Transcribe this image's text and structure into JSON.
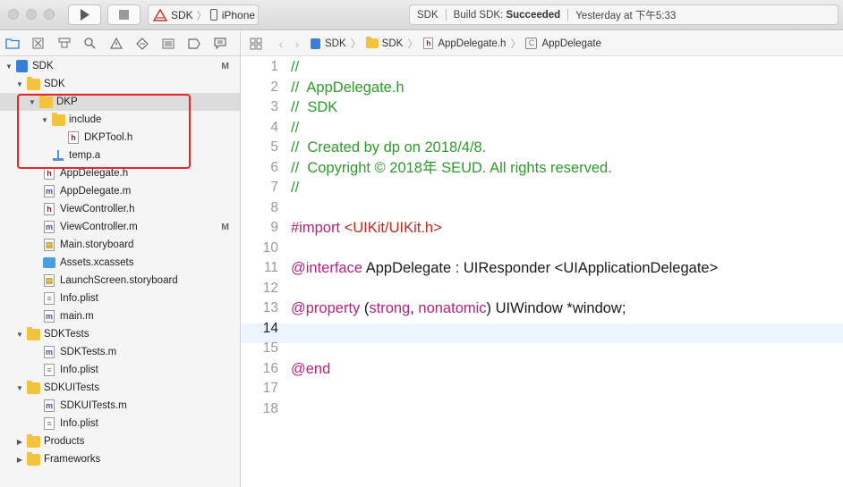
{
  "toolbar": {
    "scheme_target": "SDK",
    "scheme_device": "iPhone",
    "status_project": "SDK",
    "status_message_prefix": "Build SDK: ",
    "status_message_result": "Succeeded",
    "status_time": "Yesterday at 下午5:33"
  },
  "jumpbar": {
    "crumbs": [
      "SDK",
      "SDK",
      "AppDelegate.h",
      "AppDelegate"
    ]
  },
  "navigator": {
    "items": [
      {
        "label": "SDK",
        "badge": "M"
      },
      {
        "label": "SDK",
        "badge": ""
      },
      {
        "label": "DKP",
        "badge": ""
      },
      {
        "label": "include",
        "badge": ""
      },
      {
        "label": "DKPTool.h",
        "badge": ""
      },
      {
        "label": "temp.a",
        "badge": ""
      },
      {
        "label": "AppDelegate.h",
        "badge": ""
      },
      {
        "label": "AppDelegate.m",
        "badge": ""
      },
      {
        "label": "ViewController.h",
        "badge": ""
      },
      {
        "label": "ViewController.m",
        "badge": "M"
      },
      {
        "label": "Main.storyboard",
        "badge": ""
      },
      {
        "label": "Assets.xcassets",
        "badge": ""
      },
      {
        "label": "LaunchScreen.storyboard",
        "badge": ""
      },
      {
        "label": "Info.plist",
        "badge": ""
      },
      {
        "label": "main.m",
        "badge": ""
      },
      {
        "label": "SDKTests",
        "badge": ""
      },
      {
        "label": "SDKTests.m",
        "badge": ""
      },
      {
        "label": "Info.plist",
        "badge": ""
      },
      {
        "label": "SDKUITests",
        "badge": ""
      },
      {
        "label": "SDKUITests.m",
        "badge": ""
      },
      {
        "label": "Info.plist",
        "badge": ""
      },
      {
        "label": "Products",
        "badge": ""
      },
      {
        "label": "Frameworks",
        "badge": ""
      }
    ]
  },
  "editor": {
    "line_numbers": [
      "1",
      "2",
      "3",
      "4",
      "5",
      "6",
      "7",
      "8",
      "9",
      "10",
      "11",
      "12",
      "13",
      "14",
      "15",
      "16",
      "17",
      "18"
    ],
    "current_line": "14",
    "code": {
      "l1": "//",
      "l2": "//  AppDelegate.h",
      "l3": "//  SDK",
      "l4": "//",
      "l5": "//  Created by dp on 2018/4/8.",
      "l6": "//  Copyright © 2018年 SEUD. All rights reserved.",
      "l7": "//",
      "l9_kw": "#import ",
      "l9_str": "<UIKit/UIKit.h>",
      "l11_kw": "@interface",
      "l11_rest": " AppDelegate : UIResponder <UIApplicationDelegate>",
      "l13_kw": "@property",
      "l13_p1": " (",
      "l13_kw2": "strong",
      "l13_p2": ", ",
      "l13_kw3": "nonatomic",
      "l13_p3": ") UIWindow *window;",
      "l16_kw": "@end"
    }
  },
  "colors": {
    "comment": "#2d9a2d",
    "keyword": "#b4237e",
    "string": "#c4281d",
    "highlight_box": "#e8262e",
    "current_line_bg": "#ecf5ff"
  }
}
